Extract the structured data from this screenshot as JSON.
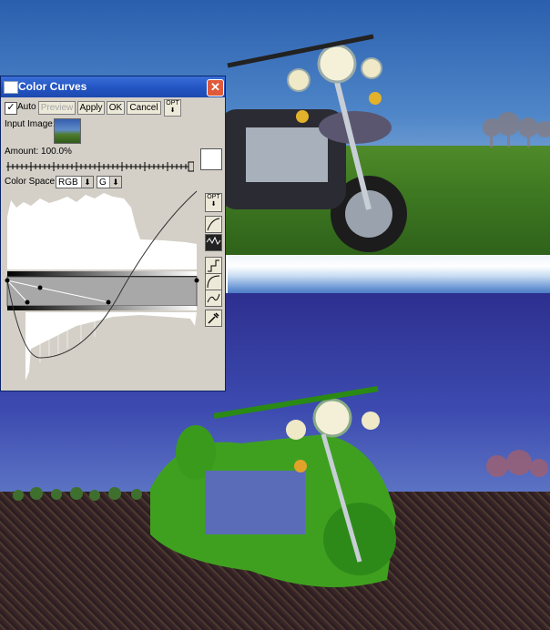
{
  "dialog": {
    "title": "Color Curves",
    "auto_label": "Auto",
    "auto_checked": true,
    "preview_label": "Preview",
    "apply_label": "Apply",
    "ok_label": "OK",
    "cancel_label": "Cancel",
    "opt_label": "OPT",
    "input_image_label": "Input Image:",
    "amount_label": "Amount: 100.0%",
    "amount_value": 1.0,
    "color_space_label": "Color Space:",
    "color_space_value": "RGB",
    "channel_value": "G",
    "curve_opt_label": "OPT"
  },
  "colors": {
    "dialog_bg": "#d4d0c8",
    "titlebar": "#2456c4",
    "close": "#e05a3a",
    "bike_highlight": "#3fa020"
  },
  "icons": [
    "window-icon",
    "close-icon",
    "dropdown-arrow-icon",
    "curve-tool-icon",
    "histogram-toggle-icon",
    "step-curve-icon",
    "smooth-curve-icon",
    "wave-curve-icon",
    "eyedropper-icon"
  ]
}
